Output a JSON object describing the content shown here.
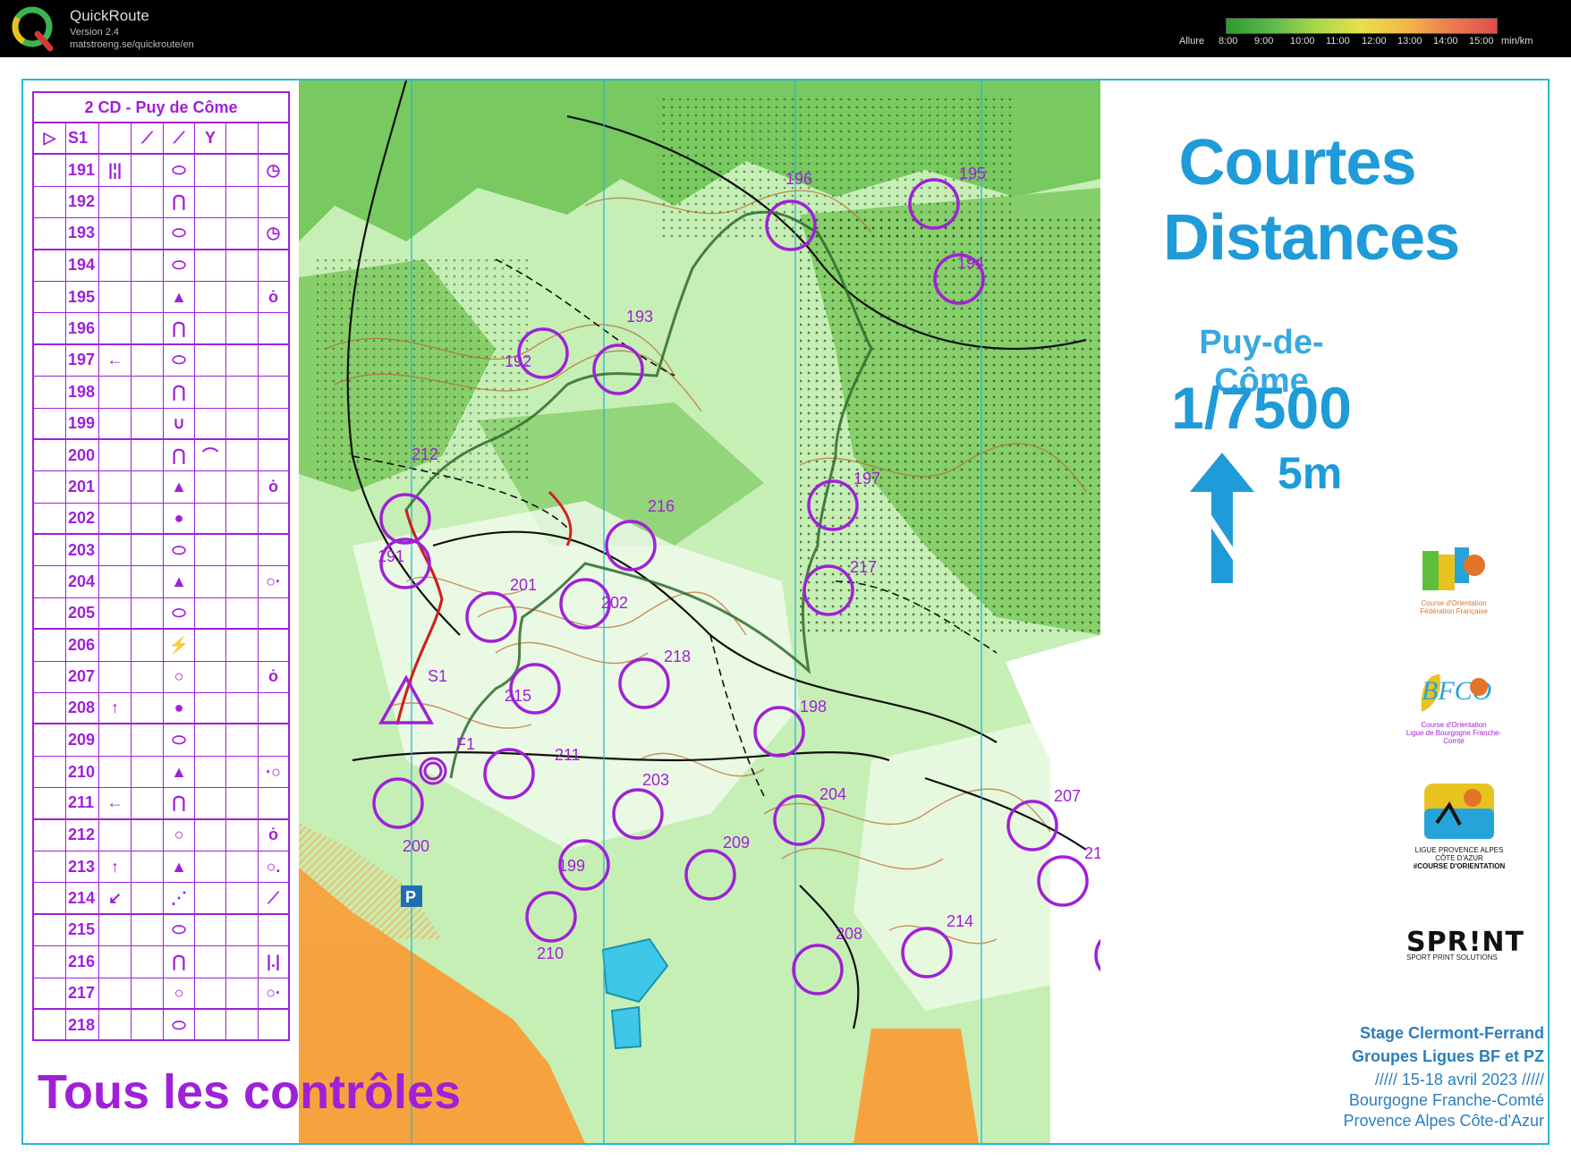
{
  "app": {
    "name": "QuickRoute",
    "version": "Version 2.4",
    "url": "matstroeng.se/quickroute/en",
    "pace_label": "Allure",
    "pace_ticks": [
      "8:00",
      "9:00",
      "10:00",
      "11:00",
      "12:00",
      "13:00",
      "14:00",
      "15:00",
      "min/km"
    ]
  },
  "map": {
    "title_line1": "Courtes",
    "title_line2": "Distances",
    "place": "Puy-de-Côme",
    "scale": "1/7500",
    "equidistance": "5m",
    "all_controls": "Tous les contrôles",
    "stage_line1": "Stage Clermont-Ferrand",
    "stage_line2": "Groupes Ligues BF et PZ",
    "stage_line3": "///// 15-18 avril 2023 /////",
    "stage_line4": "Bourgogne Franche-Comté",
    "stage_line5": "Provence Alpes Côte-d'Azur",
    "parking": "P",
    "start": "S1",
    "finish": "F1",
    "logos": {
      "ffco_caption1": "Course d'Orientation",
      "ffco_caption2": "Fédération Française",
      "bfco_caption1": "Course d'Orientation",
      "bfco_caption2": "Ligue de Bourgogne Franche-Comté",
      "pz_caption1": "LIGUE PROVENCE ALPES CÔTE D'AZUR",
      "pz_caption2": "#COURSE D'ORIENTATION",
      "sprint": "SPR!NT",
      "sprint_sub": "SPORT PRINT SOLUTIONS"
    },
    "controls": [
      {
        "n": "191"
      },
      {
        "n": "192"
      },
      {
        "n": "193"
      },
      {
        "n": "194"
      },
      {
        "n": "195"
      },
      {
        "n": "196"
      },
      {
        "n": "197"
      },
      {
        "n": "198"
      },
      {
        "n": "199"
      },
      {
        "n": "200"
      },
      {
        "n": "201"
      },
      {
        "n": "202"
      },
      {
        "n": "203"
      },
      {
        "n": "204"
      },
      {
        "n": "205"
      },
      {
        "n": "206"
      },
      {
        "n": "207"
      },
      {
        "n": "208"
      },
      {
        "n": "209"
      },
      {
        "n": "210"
      },
      {
        "n": "211"
      },
      {
        "n": "212"
      },
      {
        "n": "213"
      },
      {
        "n": "214"
      },
      {
        "n": "215"
      },
      {
        "n": "216"
      },
      {
        "n": "217"
      },
      {
        "n": "218"
      }
    ]
  },
  "cd": {
    "title": "2 CD - Puy de Côme",
    "start_code": "S1",
    "rows": [
      {
        "code": "191",
        "c2": "|¦|",
        "c4": "⬭",
        "c7": "◷"
      },
      {
        "code": "192",
        "c4": "⋂"
      },
      {
        "code": "193",
        "c4": "⬭",
        "c7": "◷"
      },
      {
        "code": "194",
        "c4": "⬭"
      },
      {
        "code": "195",
        "c4": "▲",
        "c7": "ȯ"
      },
      {
        "code": "196",
        "c4": "⋂"
      },
      {
        "code": "197",
        "c2": "←",
        "c4": "⬭"
      },
      {
        "code": "198",
        "c4": "⋂"
      },
      {
        "code": "199",
        "c4": "∪"
      },
      {
        "code": "200",
        "c4": "⋂",
        "c5": "⌒"
      },
      {
        "code": "201",
        "c4": "▲",
        "c7": "ȯ"
      },
      {
        "code": "202",
        "c4": "●"
      },
      {
        "code": "203",
        "c4": "⬭"
      },
      {
        "code": "204",
        "c4": "▲",
        "c7": "○·"
      },
      {
        "code": "205",
        "c4": "⬭"
      },
      {
        "code": "206",
        "c4": "⚡"
      },
      {
        "code": "207",
        "c4": "○",
        "c7": "ȯ"
      },
      {
        "code": "208",
        "c2": "↑",
        "c4": "●"
      },
      {
        "code": "209",
        "c4": "⬭"
      },
      {
        "code": "210",
        "c4": "▲",
        "c7": "·○"
      },
      {
        "code": "211",
        "c2": "←",
        "c4": "⋂"
      },
      {
        "code": "212",
        "c4": "○",
        "c7": "ȯ"
      },
      {
        "code": "213",
        "c2": "↑",
        "c4": "▲",
        "c7": "○."
      },
      {
        "code": "214",
        "c2": "↙",
        "c4": "⋰",
        "c7": "⟋"
      },
      {
        "code": "215",
        "c4": "⬭"
      },
      {
        "code": "216",
        "c4": "⋂",
        "c7": "|.|"
      },
      {
        "code": "217",
        "c4": "○",
        "c7": "○·"
      },
      {
        "code": "218",
        "c4": "⬭"
      }
    ]
  },
  "colors": {
    "course": "#a020d8",
    "route": "#d21f1f",
    "frame": "#2bb6d6",
    "title": "#1e9bd8"
  }
}
